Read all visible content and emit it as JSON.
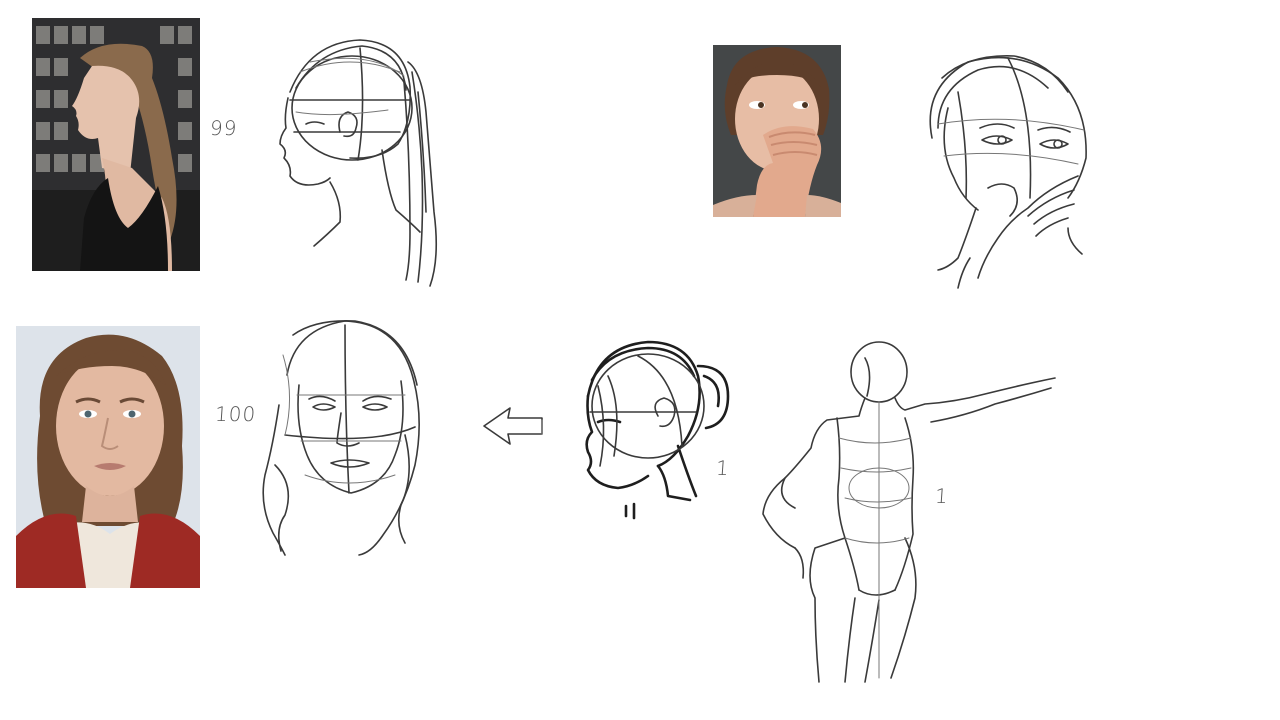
{
  "labels": {
    "study_99": "99",
    "study_100": "100",
    "mark_head_bun": "1",
    "mark_figure": "1"
  }
}
